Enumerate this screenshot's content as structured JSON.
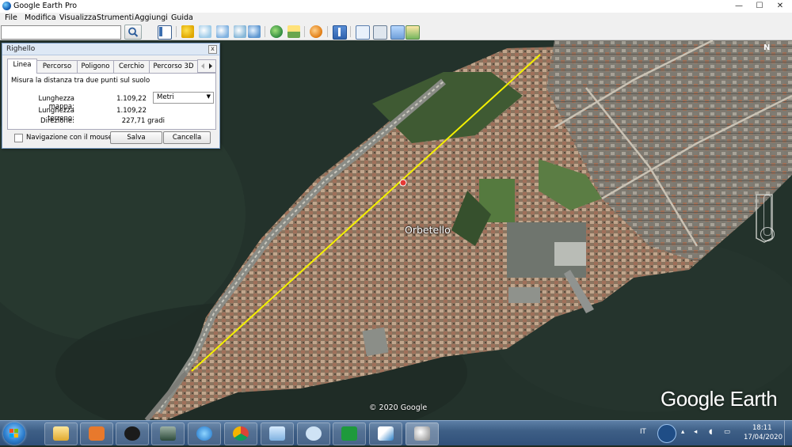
{
  "window": {
    "title": "Google Earth Pro",
    "minimize": "—",
    "maximize": "☐",
    "close": "✕"
  },
  "menu": [
    "File",
    "Modifica",
    "Visualizza",
    "Strumenti",
    "Aggiungi",
    "Guida"
  ],
  "search": {
    "value": "",
    "placeholder": ""
  },
  "toolbar_icons": [
    "sidebar-icon",
    "placemark-icon",
    "polygon-icon",
    "path-icon",
    "image-overlay-icon",
    "tour-icon",
    "historical-imagery-icon",
    "sunlight-icon",
    "planets-icon",
    "ruler-icon",
    "email-icon",
    "print-icon",
    "save-image-icon"
  ],
  "map": {
    "place_label": "Orbetello",
    "copyright": "© 2020 Google",
    "logo": "Google Earth",
    "compass_label": "N"
  },
  "ruler": {
    "title": "Righello",
    "close": "x",
    "tabs": [
      "Linea",
      "Percorso",
      "Poligono",
      "Cerchio",
      "Percorso 3D"
    ],
    "active_tab": "Linea",
    "description": "Misura la distanza tra due punti sul suolo",
    "map_length_label": "Lunghezza mappa:",
    "map_length_value": "1.109,22",
    "ground_length_label": "Lunghezza terreno:",
    "ground_length_value": "1.109,22",
    "heading_label": "Direzione:",
    "heading_value": "227,71 gradi",
    "unit": "Metri",
    "mouse_nav_label": "Navigazione con il mouse",
    "mouse_nav_checked": false,
    "save_label": "Salva",
    "cancel_label": "Cancella"
  },
  "taskbar": {
    "apps": [
      "explorer",
      "media-player",
      "hp",
      "game",
      "internet-explorer",
      "chrome",
      "notes",
      "magnifier",
      "flash-app",
      "pen-app",
      "google-earth"
    ],
    "language": "IT",
    "time": "18:11",
    "date": "17/04/2020"
  },
  "colors": {
    "measure_line": "#f4f000",
    "water": "#22302a",
    "land": "#8d7a63"
  }
}
